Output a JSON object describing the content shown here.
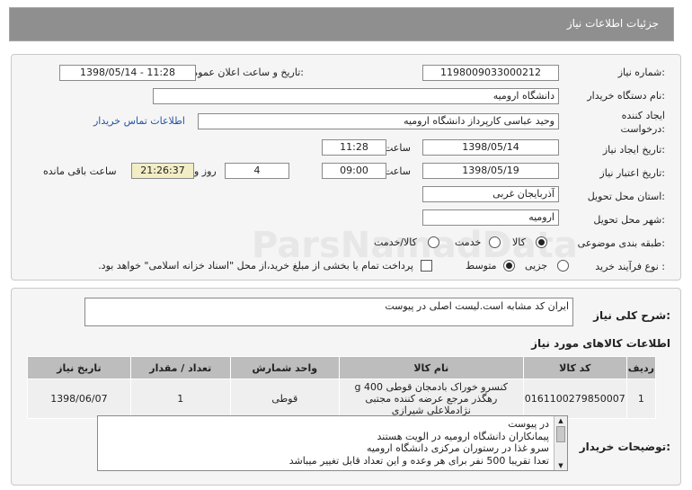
{
  "header": {
    "title": "جزئیات اطلاعات نیاز"
  },
  "form": {
    "need_number_label": "شماره نیاز:",
    "need_number": "1198009033000212",
    "announce_label": "تاریخ و ساعت اعلان عمومی:",
    "announce_value": "1398/05/14 - 11:28",
    "buyer_org_label": "نام دستگاه خریدار:",
    "buyer_org": "دانشگاه ارومیه",
    "creator_label_1": "ایجاد کننده",
    "creator_label_2": "درخواست:",
    "creator": "وحید عباسی کارپرداز دانشگاه ارومیه",
    "contact_link": "اطلاعات تماس خریدار",
    "created_date_label": "تاریخ ایجاد نیاز:",
    "created_date": "1398/05/14",
    "time_label": "ساعت",
    "created_time": "11:28",
    "valid_date_label": "تاریخ اعتبار نیاز:",
    "valid_date": "1398/05/19",
    "valid_time": "09:00",
    "days_value": "4",
    "day_and_label": "روز و",
    "remaining_time": "21:26:37",
    "remaining_label": "ساعت باقی مانده",
    "province_label": "استان محل تحویل:",
    "province": "آذربایجان غربی",
    "city_label": "شهر محل تحویل:",
    "city": "ارومیه",
    "category_label": "طبقه بندی موضوعی:",
    "category_options": [
      "کالا",
      "خدمت",
      "کالا/خدمت"
    ],
    "category_selected": 0,
    "process_label": "نوع فرآیند خرید :",
    "process_options": [
      "جزیی",
      "متوسط"
    ],
    "process_selected": 1,
    "payment_note": "پرداخت تمام یا بخشی از مبلغ خرید،از محل \"اسناد خزانه اسلامی\" خواهد بود."
  },
  "description": {
    "label": "شرح کلی نیاز:",
    "text": "ایران کد مشابه است.لیست اصلی در پیوست"
  },
  "items": {
    "section_title": "اطلاعات کالاهای مورد نیاز",
    "columns": [
      "ردیف",
      "کد کالا",
      "نام کالا",
      "واحد شمارش",
      "تعداد / مقدار",
      "تاریخ نیاز"
    ],
    "rows": [
      {
        "row": "1",
        "code": "0161100279850007",
        "name": "کنسرو خوراک بادمجان قوطی 400 g رهگذر مرجع عرضه کننده مجتبی نژادملاعلی شیرازی",
        "unit": "قوطی",
        "qty": "1",
        "date": "1398/06/07"
      }
    ]
  },
  "buyer_notes": {
    "label": "توضیحات خریدار:",
    "lines": [
      "در پیوست",
      "پیمانکاران دانشگاه ارومیه در الویت هستند",
      "سرو غذا در رستوران مرکزی دانشگاه ارومیه",
      "تعدا تقریبا 500 نفر برای هر وعده و این تعداد قابل تغییر میباشد"
    ]
  }
}
